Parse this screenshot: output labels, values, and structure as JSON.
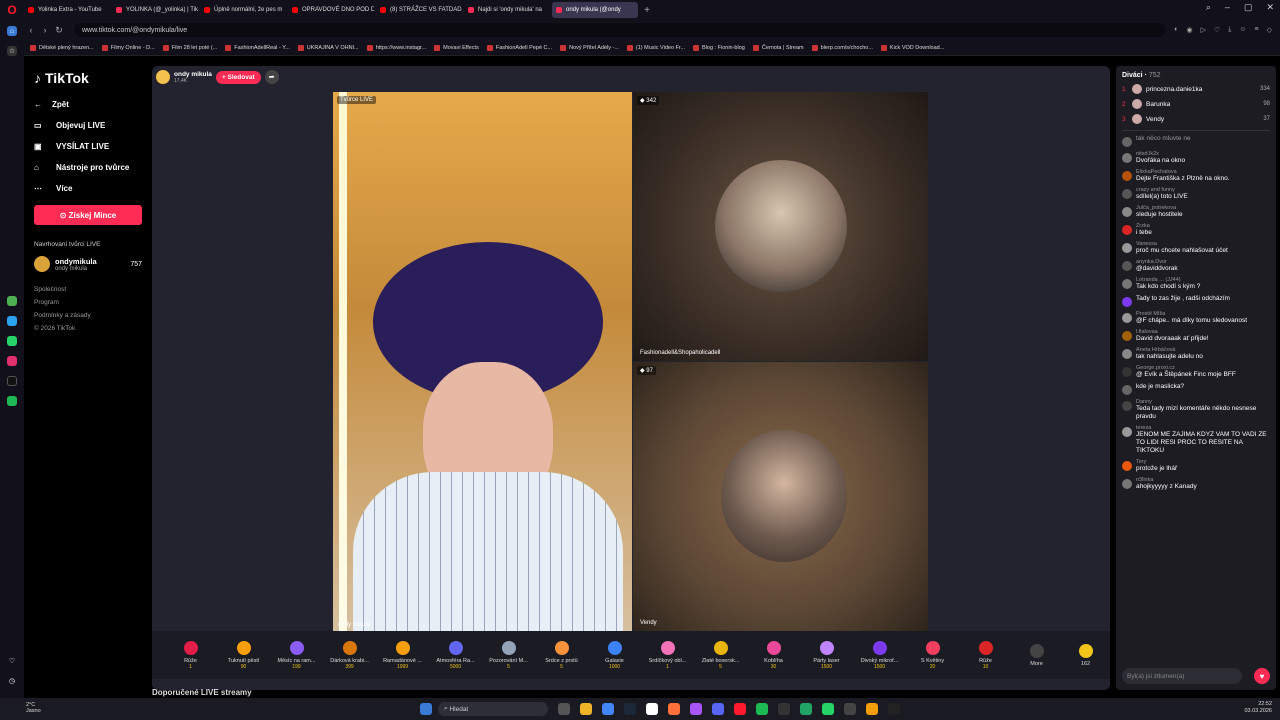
{
  "browser": {
    "tabs": [
      {
        "label": "Yolinka Extra - YouTube",
        "active": false
      },
      {
        "label": "YOLINKA (@_yolinka) | Tik",
        "active": false
      },
      {
        "label": "Úplně normální, že pes m",
        "active": false
      },
      {
        "label": "OPRAVDOVÉ DNO POD D",
        "active": false
      },
      {
        "label": "(8) STRÁŽCE VS FATDAD",
        "active": false
      },
      {
        "label": "Najdi si 'ondy mikula' na",
        "active": false
      },
      {
        "label": "ondy mikula (@ondy",
        "active": true
      }
    ],
    "url": "www.tiktok.com/@ondymikula/live",
    "bookmarks": [
      "Dětské plený hrazen...",
      "Filmy Online - D...",
      "Film 28 let poté (...",
      "FashionAdellReal - Y...",
      "UKRAJINA V OHNI...",
      "https://www.instagr...",
      "Movavi Effects",
      "FashionAdell Pepé C...",
      "Nový Přítel Adély -...",
      "(1) Music Video Fr...",
      "Blog : Fionin-blog",
      "Černota | Stream",
      "blerp.com/s/chocho...",
      "Kick VOD Download..."
    ]
  },
  "sidebar": {
    "logo": "TikTok",
    "back": "Zpět",
    "items": [
      {
        "label": "Objevuj LIVE",
        "icon": "live-icon"
      },
      {
        "label": "VYSÍLAT LIVE",
        "icon": "camera-icon"
      },
      {
        "label": "Nástroje pro tvůrce",
        "icon": "home-icon"
      },
      {
        "label": "Více",
        "icon": "more-icon"
      }
    ],
    "coins_button": "Získej Mince",
    "suggested_heading": "Navrhovaní tvůrci LIVE",
    "creator_name": "ondymikula",
    "creator_sub": "ondy mikula",
    "creator_count": "757",
    "footer": [
      "Společnost",
      "Program",
      "Podmínky a zásady",
      "© 2026 TikTok"
    ]
  },
  "stream": {
    "host_name": "ondy mikula",
    "host_likes": "17,4K",
    "follow_label": "+ Sledovat",
    "host_badge": "Tvůrce LIVE",
    "host_watermark": "ondy mikula",
    "guest1_count": "342",
    "guest1_name": "Fashionadell&Shopaholicadell",
    "guest2_count": "97",
    "guest2_name": "Vendy"
  },
  "gifts": [
    {
      "name": "Růže",
      "cost": "1"
    },
    {
      "name": "Ťuknutí pěstí",
      "cost": "90"
    },
    {
      "name": "Měsíc na ram...",
      "cost": "199"
    },
    {
      "name": "Dárková krabi...",
      "cost": "399"
    },
    {
      "name": "Ramadánové ...",
      "cost": "1999"
    },
    {
      "name": "Atmosféra Ra...",
      "cost": "5000"
    },
    {
      "name": "Pozorování M...",
      "cost": "5"
    },
    {
      "name": "Srdce z prstů",
      "cost": "5"
    },
    {
      "name": "Galaxie",
      "cost": "1000"
    },
    {
      "name": "Srdíčkový obl...",
      "cost": "1"
    },
    {
      "name": "Zlaté boxersk...",
      "cost": "5"
    },
    {
      "name": "Koblíha",
      "cost": "30"
    },
    {
      "name": "Párty laser",
      "cost": "1500"
    },
    {
      "name": "Divoký mikrof...",
      "cost": "1500"
    },
    {
      "name": "S Květiny",
      "cost": "20"
    },
    {
      "name": "Růže",
      "cost": "10"
    }
  ],
  "more_label": "More",
  "coin_balance": "162",
  "recommended_heading": "Doporučené LIVE streamy",
  "chat": {
    "viewers_title": "Diváci",
    "viewers_count": "752",
    "top": [
      {
        "rank": "1",
        "name": "princezna.danie1ka",
        "score": "334"
      },
      {
        "rank": "2",
        "name": "Barunka",
        "score": "98"
      },
      {
        "rank": "3",
        "name": "Vendy",
        "score": "37"
      }
    ],
    "messages": [
      {
        "name": "",
        "text": "tak něco mluvte ne"
      },
      {
        "name": "nitxd.lk2x",
        "text": "Dvořáka na okno"
      },
      {
        "name": "ElixkaPechatova",
        "text": "Dejte Františka z Plzně na okno."
      },
      {
        "name": "crazy and funny",
        "text": "sdílel(a) toto LIVE"
      },
      {
        "name": "Julča_potrekova",
        "text": "sleduje hostitele"
      },
      {
        "name": "Zrzka",
        "text": "i tebe"
      },
      {
        "name": "Vanessa",
        "text": "proč mu chcete nahlašovat účet"
      },
      {
        "name": "anynka.Dvor",
        "text": "@daviddvorak"
      },
      {
        "name": "Lotranda ... (JJ44)",
        "text": "Tak kdo chodí s kým ?"
      },
      {
        "name": "",
        "text": "Tady to zas žije , radši odcházím"
      },
      {
        "name": "Prostě Míša",
        "text": "@F chápe.. má díky tomu sledovanost"
      },
      {
        "name": "l.fialovaa",
        "text": "David dvoraaak ať přijde!"
      },
      {
        "name": "Aneta Hrbáčová",
        "text": "tak nahlasujte adelu no"
      },
      {
        "name": "George.proxi.cz",
        "text": "@ Evík a Štěpánek Finc moje BFF"
      },
      {
        "name": "",
        "text": "kde je maslicka?"
      },
      {
        "name": "Danny",
        "text": "Teda tady mizí komentáře někdo nesnese pravdu"
      },
      {
        "name": "tereza",
        "text": "JENOM ME ZAJIMA KDYZ VAM TO VADI ZE TO LIDI RESI PROC TO RESITE NA TIKTOKU"
      },
      {
        "name": "Tery",
        "text": "protože je lhář"
      },
      {
        "name": "n3linka",
        "text": "ahojkyyyyy z Kanady"
      }
    ],
    "input_placeholder": "Byl(a) jsi ztlumen(a)"
  },
  "taskbar": {
    "weather_temp": "2°C",
    "weather_text": "Jasno",
    "search_label": "Hledat",
    "time": "22:52",
    "date": "03.03.2026"
  },
  "colors": {
    "accent": "#fe2c55",
    "chat_bg": "#1c1c22",
    "panel_bg": "#232330"
  }
}
